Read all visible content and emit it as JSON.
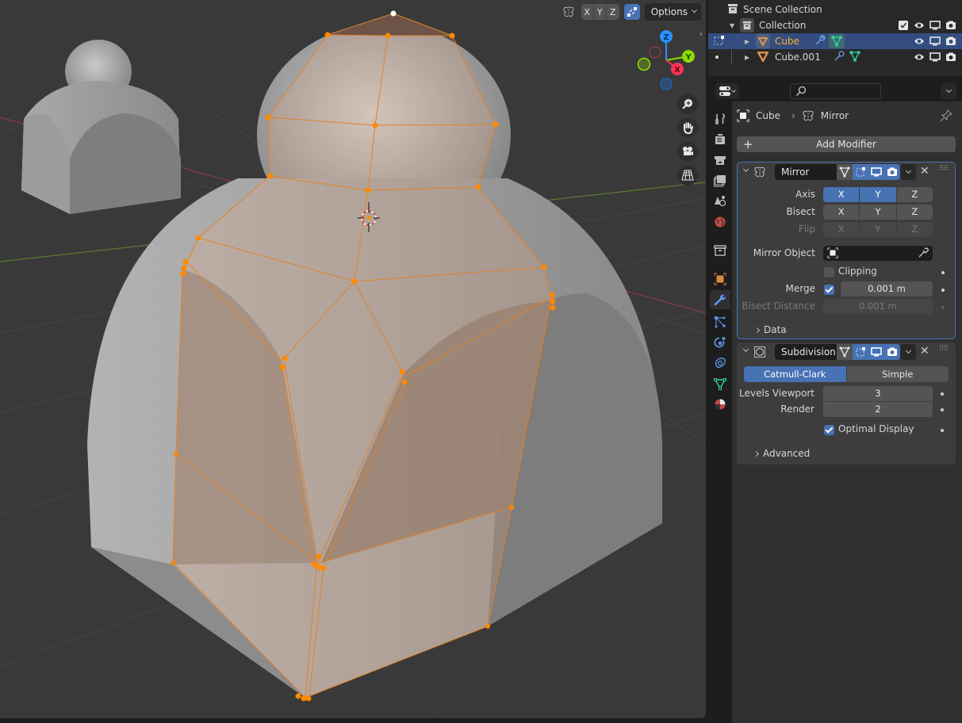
{
  "viewport": {
    "header": {
      "mirror_axes": [
        "X",
        "Y",
        "Z"
      ],
      "options_label": "Options"
    },
    "gizmo_axes": {
      "z": "Z",
      "y": "Y",
      "x": "X"
    },
    "colors": {
      "selection_orange": "#ff8a00",
      "x_axis": "#ff3352",
      "y_axis": "#8bdc00",
      "z_axis": "#2890ff",
      "background": "#393939"
    }
  },
  "outliner": {
    "scene_collection": "Scene Collection",
    "collection": "Collection",
    "objects": [
      {
        "name": "Cube",
        "selected": true
      },
      {
        "name": "Cube.001",
        "selected": false
      }
    ]
  },
  "properties": {
    "search_placeholder": "",
    "breadcrumb": {
      "object": "Cube",
      "modifier": "Mirror"
    },
    "add_modifier_label": "Add Modifier",
    "mirror": {
      "name": "Mirror",
      "axis_label": "Axis",
      "bisect_label": "Bisect",
      "flip_label": "Flip",
      "axes": [
        "X",
        "Y",
        "Z"
      ],
      "axis_enabled": [
        true,
        true,
        false
      ],
      "mirror_object_label": "Mirror Object",
      "clipping_label": "Clipping",
      "clipping_checked": false,
      "merge_label": "Merge",
      "merge_checked": true,
      "merge_value": "0.001 m",
      "bisect_distance_label": "Bisect Distance",
      "bisect_distance_value": "0.001 m",
      "data_label": "Data"
    },
    "subdivision": {
      "name": "Subdivision",
      "mode_options": [
        "Catmull-Clark",
        "Simple"
      ],
      "mode_selected": "Catmull-Clark",
      "levels_viewport_label": "Levels Viewport",
      "levels_viewport_value": "3",
      "render_label": "Render",
      "render_value": "2",
      "optimal_display_label": "Optimal Display",
      "optimal_display_checked": true,
      "advanced_label": "Advanced"
    }
  }
}
